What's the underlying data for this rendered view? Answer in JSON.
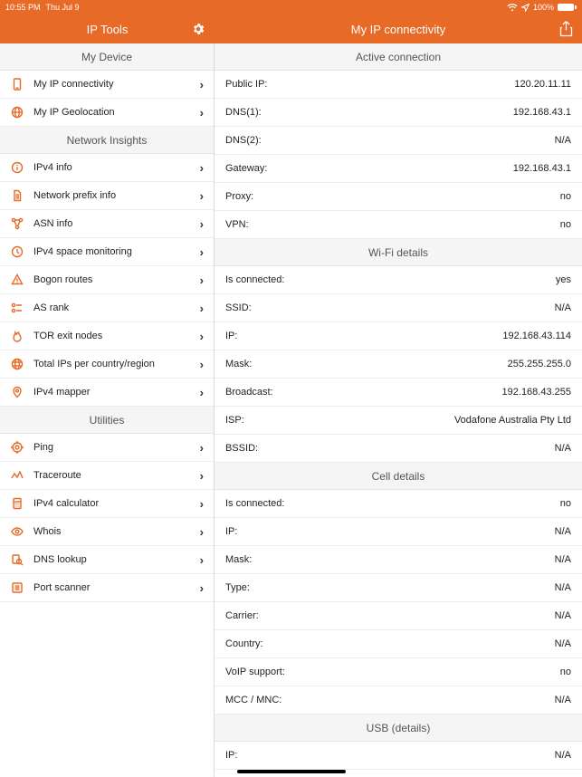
{
  "statusbar": {
    "time": "10:55 PM",
    "date": "Thu Jul 9",
    "battery": "100%"
  },
  "nav": {
    "left_title": "IP Tools",
    "right_title": "My IP connectivity"
  },
  "sidebar": {
    "sections": [
      {
        "title": "My Device",
        "items": [
          {
            "icon": "phone",
            "label": "My IP connectivity"
          },
          {
            "icon": "globe",
            "label": "My IP Geolocation"
          }
        ]
      },
      {
        "title": "Network Insights",
        "items": [
          {
            "icon": "info",
            "label": "IPv4 info"
          },
          {
            "icon": "doc",
            "label": "Network prefix info"
          },
          {
            "icon": "nodes",
            "label": "ASN info"
          },
          {
            "icon": "clock",
            "label": "IPv4 space monitoring"
          },
          {
            "icon": "warn",
            "label": "Bogon routes"
          },
          {
            "icon": "rank",
            "label": "AS rank"
          },
          {
            "icon": "tor",
            "label": "TOR exit nodes"
          },
          {
            "icon": "globegrid",
            "label": "Total IPs per country/region"
          },
          {
            "icon": "map",
            "label": "IPv4 mapper"
          }
        ]
      },
      {
        "title": "Utilities",
        "items": [
          {
            "icon": "target",
            "label": "Ping"
          },
          {
            "icon": "trace",
            "label": "Traceroute"
          },
          {
            "icon": "calc",
            "label": "IPv4 calculator"
          },
          {
            "icon": "eye",
            "label": "Whois"
          },
          {
            "icon": "search",
            "label": "DNS lookup"
          },
          {
            "icon": "ports",
            "label": "Port scanner"
          }
        ]
      }
    ]
  },
  "content": {
    "sections": [
      {
        "title": "Active connection",
        "rows": [
          {
            "k": "Public IP:",
            "v": "120.20.11.11"
          },
          {
            "k": "DNS(1):",
            "v": "192.168.43.1"
          },
          {
            "k": "DNS(2):",
            "v": "N/A"
          },
          {
            "k": "Gateway:",
            "v": "192.168.43.1"
          },
          {
            "k": "Proxy:",
            "v": "no"
          },
          {
            "k": "VPN:",
            "v": "no"
          }
        ]
      },
      {
        "title": "Wi-Fi details",
        "rows": [
          {
            "k": "Is connected:",
            "v": "yes"
          },
          {
            "k": "SSID:",
            "v": "N/A"
          },
          {
            "k": "IP:",
            "v": "192.168.43.114"
          },
          {
            "k": "Mask:",
            "v": "255.255.255.0"
          },
          {
            "k": "Broadcast:",
            "v": "192.168.43.255"
          },
          {
            "k": "ISP:",
            "v": "Vodafone Australia Pty Ltd"
          },
          {
            "k": "BSSID:",
            "v": "N/A"
          }
        ]
      },
      {
        "title": "Cell details",
        "rows": [
          {
            "k": "Is connected:",
            "v": "no"
          },
          {
            "k": "IP:",
            "v": "N/A"
          },
          {
            "k": "Mask:",
            "v": "N/A"
          },
          {
            "k": "Type:",
            "v": "N/A"
          },
          {
            "k": "Carrier:",
            "v": "N/A"
          },
          {
            "k": "Country:",
            "v": "N/A"
          },
          {
            "k": "VoIP support:",
            "v": "no"
          },
          {
            "k": "MCC / MNC:",
            "v": "N/A"
          }
        ]
      },
      {
        "title": "USB (details)",
        "rows": [
          {
            "k": "IP:",
            "v": "N/A"
          }
        ]
      }
    ]
  }
}
